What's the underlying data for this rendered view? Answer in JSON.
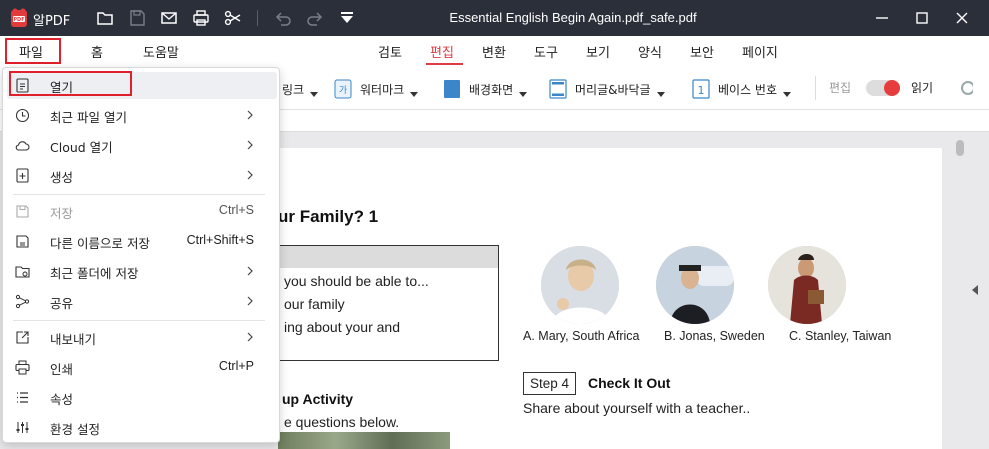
{
  "app": {
    "name": "알PDF",
    "document_title": "Essential English Begin Again.pdf_safe.pdf"
  },
  "menubar": {
    "left": [
      "파일",
      "홈",
      "도움말"
    ],
    "tabs": [
      "검토",
      "편집",
      "변환",
      "도구",
      "보기",
      "양식",
      "보안",
      "페이지"
    ],
    "active_tab": "편집"
  },
  "toolbar": {
    "link": "링크",
    "watermark": "워터마크",
    "background": "배경화면",
    "header_footer": "머리글&바닥글",
    "bates": "베이스 번호",
    "edit": "편집",
    "read": "읽기",
    "bates_icon_text": "1",
    "watermark_icon_text": "가"
  },
  "file_menu": {
    "items": [
      {
        "label": "열기",
        "icon": "open-file-icon",
        "shortcut": "",
        "submenu": false
      },
      {
        "label": "최근 파일 열기",
        "icon": "clock-icon",
        "shortcut": "",
        "submenu": true
      },
      {
        "label": "Cloud 열기",
        "icon": "cloud-icon",
        "shortcut": "",
        "submenu": true
      },
      {
        "label": "생성",
        "icon": "new-file-icon",
        "shortcut": "",
        "submenu": true
      },
      {
        "label": "저장",
        "icon": "save-icon",
        "shortcut": "Ctrl+S",
        "submenu": false,
        "disabled": true
      },
      {
        "label": "다른 이름으로 저장",
        "icon": "save-as-icon",
        "shortcut": "Ctrl+Shift+S",
        "submenu": false
      },
      {
        "label": "최근 폴더에 저장",
        "icon": "folder-save-icon",
        "shortcut": "",
        "submenu": true
      },
      {
        "label": "공유",
        "icon": "share-icon",
        "shortcut": "",
        "submenu": true
      },
      {
        "label": "내보내기",
        "icon": "export-icon",
        "shortcut": "",
        "submenu": true
      },
      {
        "label": "인쇄",
        "icon": "print-icon",
        "shortcut": "Ctrl+P",
        "submenu": false
      },
      {
        "label": "속성",
        "icon": "properties-icon",
        "shortcut": "",
        "submenu": false
      },
      {
        "label": "환경 설정",
        "icon": "settings-icon",
        "shortcut": "",
        "submenu": false
      }
    ]
  },
  "document": {
    "heading": "ur Family? 1",
    "box_lines": [
      "you should be able to...",
      "our family",
      "ing about your and"
    ],
    "activity_heading": "up Activity",
    "activity_text": "e questions below.",
    "captions": [
      "A. Mary, South Africa",
      "B. Jonas, Sweden",
      "C. Stanley, Taiwan"
    ],
    "step_label": "Step 4",
    "step_title": "Check It Out",
    "step_text": "Share about yourself with a teacher.."
  },
  "colors": {
    "accent": "#e03a44",
    "titlebar": "#2b2f3a",
    "highlight_box": "#e0202a"
  }
}
